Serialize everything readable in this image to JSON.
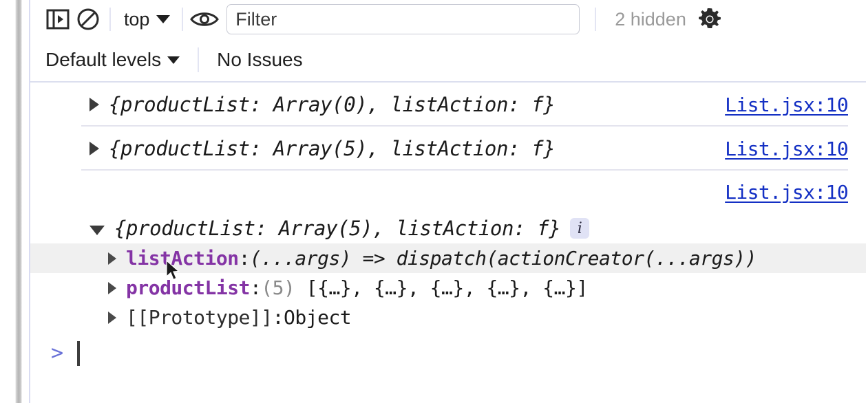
{
  "toolbar": {
    "sidebar_toggle_icon": "panel-toggle-icon",
    "clear_console_icon": "clear-console-icon",
    "context_selector": {
      "label": "top",
      "caret_icon": "chevron-down-icon"
    },
    "eye_icon": "eye-icon",
    "filter": {
      "placeholder": "Filter",
      "value": ""
    },
    "hidden_count": "2 hidden",
    "settings_icon": "gear-icon"
  },
  "toolbar2": {
    "levels": {
      "label": "Default levels",
      "caret_icon": "chevron-down-icon"
    },
    "issues": "No Issues"
  },
  "messages": [
    {
      "expand_icon": "triangle-right-icon",
      "preview": "{productList: Array(0), listAction: f}",
      "source": "List.jsx:10",
      "has_info_badge": false,
      "expanded": false
    },
    {
      "expand_icon": "triangle-right-icon",
      "preview": "{productList: Array(5), listAction: f}",
      "source": "List.jsx:10",
      "has_info_badge": false,
      "expanded": false
    },
    {
      "expand_icon": "triangle-down-icon",
      "preview": "{productList: Array(5), listAction: f}",
      "source": "List.jsx:10",
      "has_info_badge": true,
      "info_badge_label": "i",
      "expanded": true
    }
  ],
  "expanded_properties": [
    {
      "expand_icon": "triangle-right-icon",
      "key": "listAction",
      "separator": ": ",
      "value": "(...args) => dispatch(actionCreator(...args))",
      "value_style": "function",
      "count": "",
      "highlighted": true
    },
    {
      "expand_icon": "triangle-right-icon",
      "key": "productList",
      "separator": ": ",
      "count": "(5)",
      "value": "[{…}, {…}, {…}, {…}, {…}]",
      "value_style": "array",
      "highlighted": false
    },
    {
      "expand_icon": "triangle-right-icon",
      "key": "[[Prototype]]",
      "separator": ": ",
      "count": "",
      "value": "Object",
      "value_style": "proto",
      "highlighted": false
    }
  ],
  "prompt": {
    "chevron": ">",
    "input_value": ""
  },
  "colors": {
    "link": "#1430c4",
    "property_key": "#8434a5",
    "prompt_chevron": "#6a72d8",
    "info_badge_bg": "#e0e2f5",
    "row_highlight": "#f0f0f0",
    "muted_text": "#9a9a9a"
  }
}
